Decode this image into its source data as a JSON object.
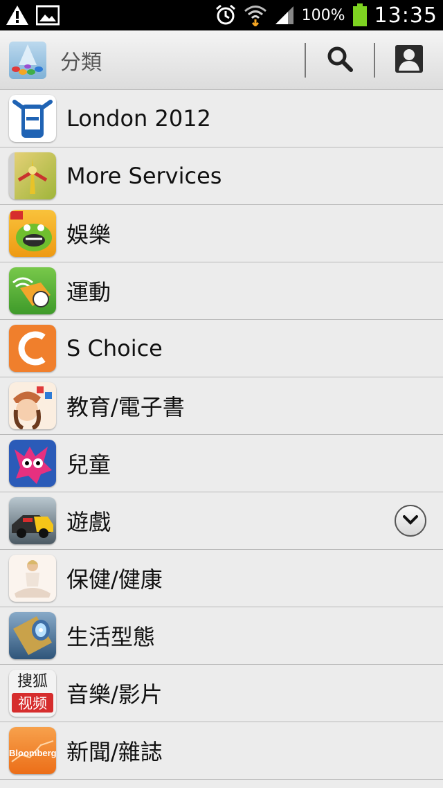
{
  "status_bar": {
    "battery_percent": "100%",
    "time": "13:35",
    "icons": [
      "warning-icon",
      "image-icon",
      "alarm-icon",
      "wifi-icon",
      "signal-icon",
      "battery-icon"
    ]
  },
  "header": {
    "title": "分類",
    "actions": [
      "search-icon",
      "account-icon"
    ]
  },
  "categories": [
    {
      "label": "London 2012",
      "icon": "london-2012-icon",
      "color": "#1f63b4"
    },
    {
      "label": "More Services",
      "icon": "more-services-icon",
      "color": "#c9a224"
    },
    {
      "label": "娛樂",
      "icon": "entertainment-icon",
      "color": "#f3a81c"
    },
    {
      "label": "運動",
      "icon": "sports-icon",
      "color": "#5fb53a"
    },
    {
      "label": "S Choice",
      "icon": "s-choice-icon",
      "color": "#f07f2c"
    },
    {
      "label": "教育/電子書",
      "icon": "education-icon",
      "color": "#e9c9a1"
    },
    {
      "label": "兒童",
      "icon": "kids-icon",
      "color": "#e6307f"
    },
    {
      "label": "遊戲",
      "icon": "games-icon",
      "color": "#394b5c"
    },
    {
      "label": "保健/健康",
      "icon": "health-icon",
      "color": "#f3e1cf"
    },
    {
      "label": "生活型態",
      "icon": "lifestyle-icon",
      "color": "#4a84c2"
    },
    {
      "label": "音樂/影片",
      "icon": "music-video-icon",
      "color": "#d62d2d",
      "icon_text_top": "搜狐",
      "icon_text_bottom": "视频"
    },
    {
      "label": "新聞/雜誌",
      "icon": "news-icon",
      "color": "#f07c22",
      "icon_text": "Bloomberg"
    }
  ]
}
